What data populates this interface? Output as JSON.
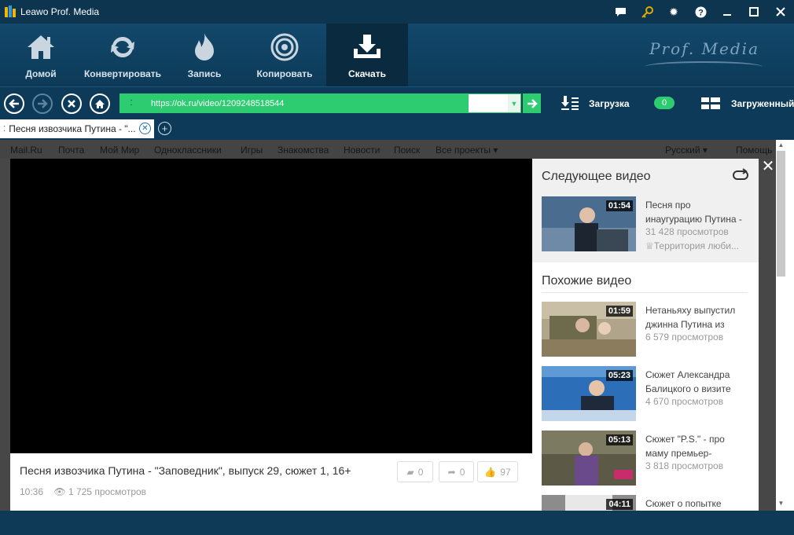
{
  "app": {
    "title": "Leawo Prof. Media",
    "brand": "Prof. Media"
  },
  "title_controls": {
    "items": [
      "chat-icon",
      "key-icon",
      "gear-icon",
      "help-icon",
      "minimize-icon",
      "maximize-icon",
      "close-icon"
    ]
  },
  "toolbar": {
    "home_label": "Домой",
    "convert_label": "Конвертировать",
    "burn_label": "Запись",
    "copy_label": "Копировать",
    "download_label": "Скачать",
    "active": "download"
  },
  "nav": {
    "url": "https://ok.ru/video/1209248518544",
    "download_label": "Загрузка",
    "download_count": "0",
    "downloaded_label": "Загруженный"
  },
  "tabs": [
    {
      "label": "Песня извозчика Путина - \"..."
    }
  ],
  "portal_nav": {
    "items": [
      "Mail.Ru",
      "Почта",
      "Мой Мир",
      "Одноклассники",
      "Игры",
      "Знакомства",
      "Новости",
      "Поиск",
      "Все проекты ▾"
    ],
    "language": "Русский ▾",
    "help": "Помощь"
  },
  "video": {
    "title": "Песня извозчика Путина - \"Заповедник\", выпуск 29, сюжет 1, 16+",
    "duration": "10:36",
    "views": "1 725 просмотров",
    "comments": "0",
    "shares": "0",
    "likes": "97"
  },
  "sidebar": {
    "next_heading": "Следующее видео",
    "similar_heading": "Похожие видео",
    "next_video": {
      "duration": "01:54",
      "title": "Песня про инаугурацию Путина -",
      "views": "31 428 просмотров",
      "channel": "Территория люби..."
    },
    "similar": [
      {
        "duration": "01:59",
        "title": "Нетаньяху выпустил джинна Путина из",
        "views": "6 579 просмотров"
      },
      {
        "duration": "05:23",
        "title": "Сюжет Александра Балицкого о визите",
        "views": "4 670 просмотров"
      },
      {
        "duration": "05:13",
        "title": "Сюжет \"P.S.\" - про маму премьер-",
        "views": "3 818 просмотров"
      },
      {
        "duration": "04:11",
        "title": "Сюжет о попытке",
        "views": ""
      }
    ]
  },
  "colors": {
    "accent": "#2ecc71",
    "toolbar_bg": "#0d3a58",
    "title_bg": "#0d3550"
  }
}
